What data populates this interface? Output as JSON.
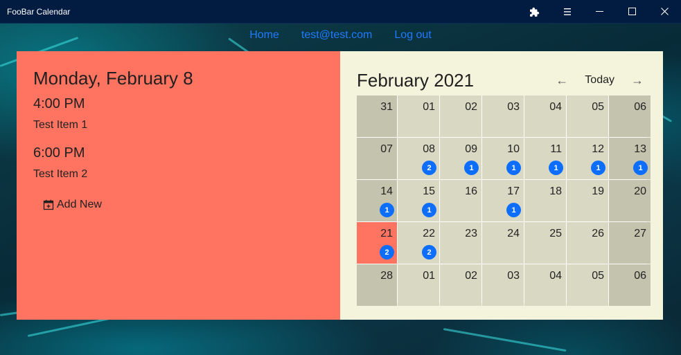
{
  "window": {
    "title": "FooBar Calendar",
    "controls": [
      "puzzle-icon",
      "menu-icon",
      "minimize-icon",
      "maximize-icon",
      "close-icon"
    ]
  },
  "nav": {
    "home": "Home",
    "user": "test@test.com",
    "logout": "Log out"
  },
  "day_panel": {
    "title": "Monday, February 8",
    "events": [
      {
        "time": "4:00 PM",
        "name": "Test Item 1"
      },
      {
        "time": "6:00 PM",
        "name": "Test Item 2"
      }
    ],
    "add_new": "Add New"
  },
  "calendar": {
    "month_title": "February 2021",
    "prev": "←",
    "today": "Today",
    "next": "→",
    "weeks": [
      [
        {
          "day": "31"
        },
        {
          "day": "01"
        },
        {
          "day": "02"
        },
        {
          "day": "03"
        },
        {
          "day": "04"
        },
        {
          "day": "05"
        },
        {
          "day": "06"
        }
      ],
      [
        {
          "day": "07"
        },
        {
          "day": "08",
          "count": "2"
        },
        {
          "day": "09",
          "count": "1"
        },
        {
          "day": "10",
          "count": "1"
        },
        {
          "day": "11",
          "count": "1"
        },
        {
          "day": "12",
          "count": "1"
        },
        {
          "day": "13",
          "count": "1"
        }
      ],
      [
        {
          "day": "14",
          "count": "1"
        },
        {
          "day": "15",
          "count": "1"
        },
        {
          "day": "16"
        },
        {
          "day": "17",
          "count": "1"
        },
        {
          "day": "18"
        },
        {
          "day": "19"
        },
        {
          "day": "20"
        }
      ],
      [
        {
          "day": "21",
          "count": "2",
          "selected": true
        },
        {
          "day": "22",
          "count": "2"
        },
        {
          "day": "23"
        },
        {
          "day": "24"
        },
        {
          "day": "25"
        },
        {
          "day": "26"
        },
        {
          "day": "27"
        }
      ],
      [
        {
          "day": "28"
        },
        {
          "day": "01"
        },
        {
          "day": "02"
        },
        {
          "day": "03"
        },
        {
          "day": "04"
        },
        {
          "day": "05"
        },
        {
          "day": "06"
        }
      ]
    ]
  },
  "colors": {
    "titlebar": "#021b40",
    "nav_link": "#1e7bff",
    "day_panel": "#ff7461",
    "calendar_panel": "#f4f4dc",
    "weekday_cell": "#d9d9c3",
    "weekend_cell": "#c4c4ae",
    "badge": "#0d6efd"
  }
}
